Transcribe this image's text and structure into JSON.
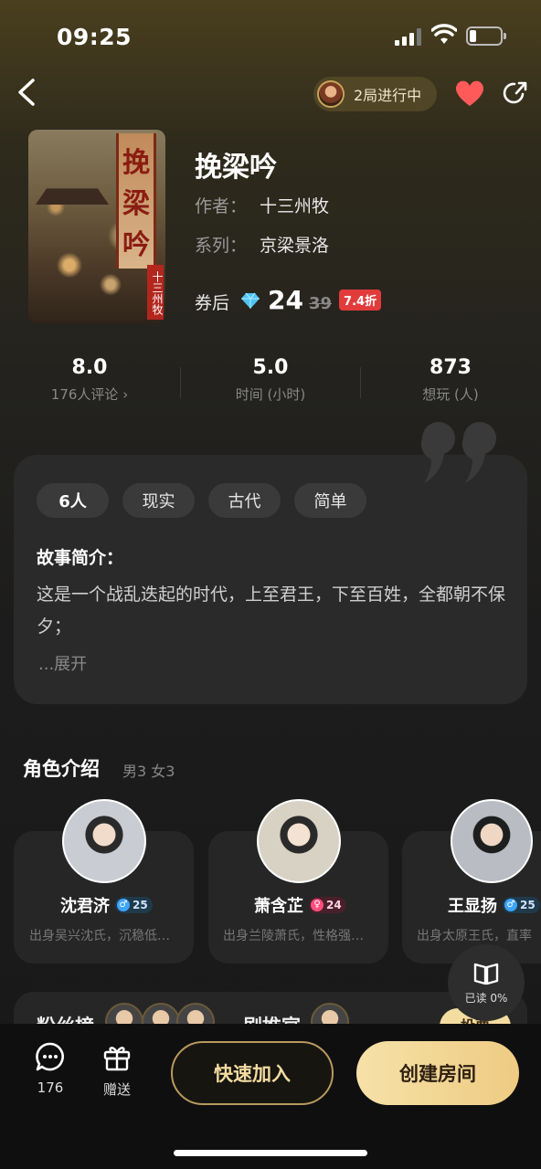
{
  "status_bar": {
    "time": "09:25"
  },
  "header": {
    "progress_label": "2局进行中"
  },
  "game": {
    "title": "挽梁吟",
    "author_label": "作者：",
    "author": "十三州牧",
    "series_label": "系列：",
    "series": "京梁景洛",
    "cover_title_chars": [
      "挽",
      "梁",
      "吟"
    ],
    "cover_author": "十三州牧",
    "price_label": "券后",
    "price_now": "24",
    "price_old": "39",
    "discount": "7.4折"
  },
  "stats": [
    {
      "value": "8.0",
      "label": "176人评论 ›"
    },
    {
      "value": "5.0",
      "label": "时间 (小时)"
    },
    {
      "value": "873",
      "label": "想玩 (人)"
    }
  ],
  "intro": {
    "tags": [
      "6人",
      "现实",
      "古代",
      "简单"
    ],
    "heading": "故事简介：",
    "text": "这是一个战乱迭起的时代，上至君王，下至百姓，全都朝不保夕；",
    "expand": "...展开"
  },
  "characters": {
    "title": "角色介绍",
    "summary": "男3 女3",
    "items": [
      {
        "name": "沈君济",
        "gender": "male",
        "age": "25",
        "desc": "出身吴兴沈氏，沉稳低…"
      },
      {
        "name": "萧含芷",
        "gender": "female",
        "age": "24",
        "desc": "出身兰陵萧氏，性格强…"
      },
      {
        "name": "王显扬",
        "gender": "male",
        "age": "25",
        "desc": "出身太原王氏，直率"
      }
    ]
  },
  "read_badge": {
    "label": "已读 0%"
  },
  "peek": {
    "left_label": "粉丝榜",
    "right_label": "剧推官",
    "button": "投票"
  },
  "bottom_bar": {
    "comments_count": "176",
    "gift_label": "赠送",
    "join_label": "快速加入",
    "create_label": "创建房间"
  },
  "colors": {
    "accent_gold": "#f3dca0",
    "discount_red": "#e23b3b",
    "heart": "#ff5a5a"
  }
}
